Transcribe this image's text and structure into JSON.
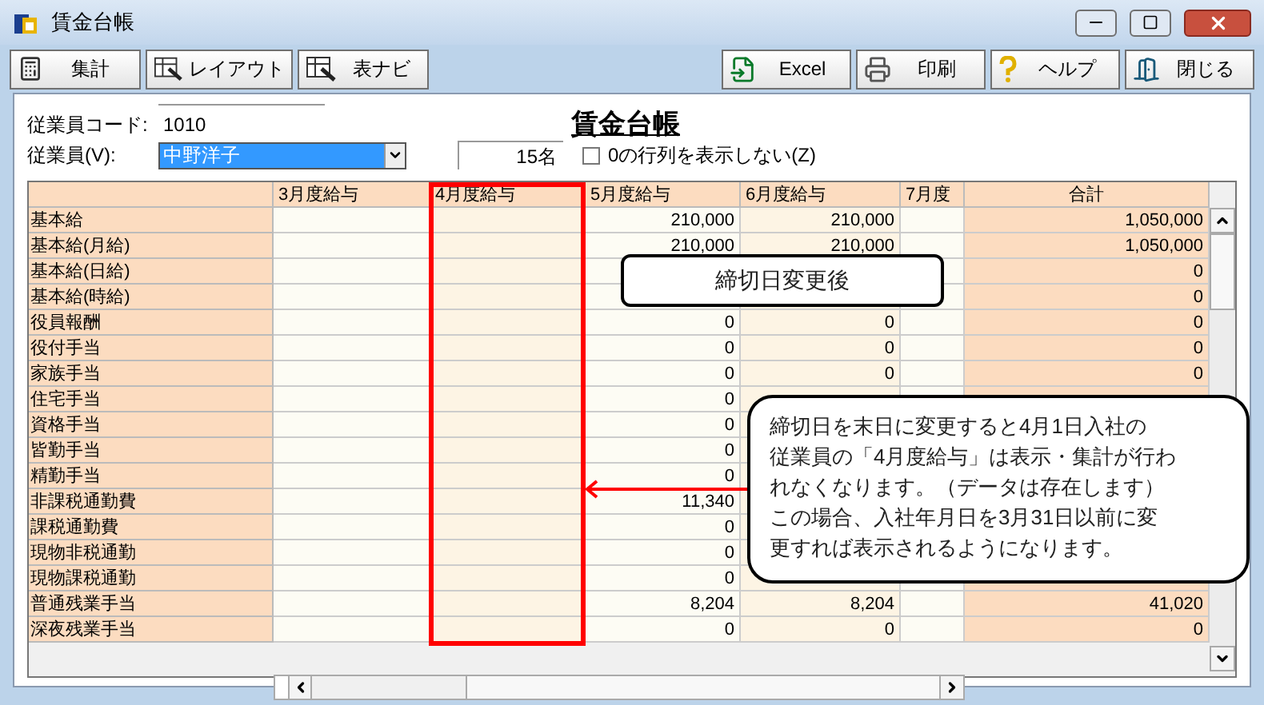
{
  "window": {
    "title": "賃金台帳"
  },
  "toolbar": [
    {
      "label": "集計",
      "kind": "calc"
    },
    {
      "label": "レイアウト",
      "kind": "layout"
    },
    {
      "label": "表ナビ",
      "kind": "layout"
    },
    {
      "label": "Excel",
      "kind": "excel"
    },
    {
      "label": "印刷",
      "kind": "print"
    },
    {
      "label": "ヘルプ",
      "kind": "help"
    },
    {
      "label": "閉じる",
      "kind": "close"
    }
  ],
  "form": {
    "title": "賃金台帳",
    "employee_code": {
      "label": "従業員コード:",
      "value": "1010"
    },
    "employee": {
      "label": "従業員(V):",
      "value": "中野洋子"
    },
    "count": "15名",
    "hide_zero": {
      "label": "0の行列を表示しない(Z)",
      "checked": false
    }
  },
  "table": {
    "columns": [
      {
        "header": "3月度給与",
        "highlighted": false
      },
      {
        "header": "4月度給与",
        "highlighted": true
      },
      {
        "header": "5月度給与",
        "highlighted": false
      },
      {
        "header": "6月度給与",
        "highlighted": false
      },
      {
        "header": "7月度",
        "highlighted": false
      },
      {
        "header": "合計",
        "highlighted": false
      }
    ],
    "rows": [
      {
        "label": "基本給",
        "cells": [
          null,
          null,
          "210,000",
          "210,000",
          null,
          "1,050,000"
        ]
      },
      {
        "label": "基本給(月給)",
        "cells": [
          null,
          null,
          "210,000",
          "210,000",
          null,
          "1,050,000"
        ]
      },
      {
        "label": "基本給(日給)",
        "cells": [
          null,
          null,
          null,
          null,
          null,
          "0"
        ]
      },
      {
        "label": "基本給(時給)",
        "cells": [
          null,
          null,
          null,
          null,
          null,
          "0"
        ]
      },
      {
        "label": "役員報酬",
        "cells": [
          null,
          null,
          "0",
          "0",
          null,
          "0"
        ]
      },
      {
        "label": "役付手当",
        "cells": [
          null,
          null,
          "0",
          "0",
          null,
          "0"
        ]
      },
      {
        "label": "家族手当",
        "cells": [
          null,
          null,
          "0",
          "0",
          null,
          "0"
        ]
      },
      {
        "label": "住宅手当",
        "cells": [
          null,
          null,
          "0",
          null,
          null,
          null
        ]
      },
      {
        "label": "資格手当",
        "cells": [
          null,
          null,
          "0",
          null,
          null,
          null
        ]
      },
      {
        "label": "皆勤手当",
        "cells": [
          null,
          null,
          "0",
          null,
          null,
          null
        ]
      },
      {
        "label": "精勤手当",
        "cells": [
          null,
          null,
          "0",
          null,
          null,
          null
        ]
      },
      {
        "label": "非課税通勤費",
        "cells": [
          null,
          null,
          "11,340",
          null,
          null,
          null
        ]
      },
      {
        "label": "課税通勤費",
        "cells": [
          null,
          null,
          "0",
          null,
          null,
          null
        ]
      },
      {
        "label": "現物非税通勤",
        "cells": [
          null,
          null,
          "0",
          null,
          null,
          null
        ]
      },
      {
        "label": "現物課税通勤",
        "cells": [
          null,
          null,
          "0",
          null,
          null,
          null
        ]
      },
      {
        "label": "普通残業手当",
        "cells": [
          null,
          null,
          "8,204",
          "8,204",
          null,
          "41,020"
        ]
      },
      {
        "label": "深夜残業手当",
        "cells": [
          null,
          null,
          "0",
          "0",
          null,
          "0"
        ]
      }
    ]
  },
  "callouts": {
    "small": "締切日変更後",
    "large": [
      "締切日を末日に変更すると4月1日入社の",
      "従業員の「4月度給与」は表示・集計が行わ",
      "れなくなります。（データは存在します）",
      "この場合、入社年月日を3月31日以前に変",
      "更すれば表示されるようになります。"
    ]
  }
}
